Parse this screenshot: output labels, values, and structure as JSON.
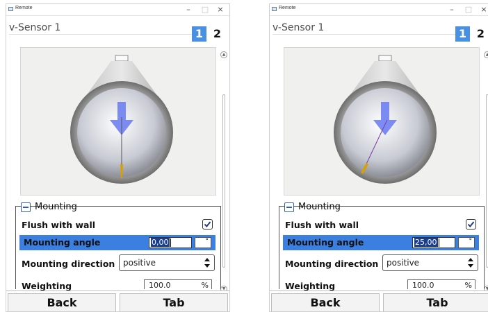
{
  "windows": [
    {
      "title": "Remote",
      "controls": {
        "minimize": "–",
        "maximize": "□",
        "close": "×"
      },
      "sensor_title": "v-Sensor 1",
      "tabs": [
        "1",
        "2"
      ],
      "mounting": {
        "group_label": "Mounting",
        "flush_label": "Flush with wall",
        "flush_checked": true,
        "angle_label": "Mounting angle",
        "angle_value": "0,00",
        "angle_unit": "°",
        "direction_label": "Mounting direction",
        "direction_value": "positive"
      },
      "weighting": {
        "label": "Weighting",
        "value": "100.0",
        "unit": "%"
      },
      "footer": {
        "back": "Back",
        "tab": "Tab"
      },
      "icons": {
        "app": "app-window-icon",
        "collapse": "collapse-minus-icon",
        "check": "checkmark-icon",
        "spinner": "up-down-arrows-icon"
      },
      "colors": {
        "highlight": "#3b7fe0",
        "tab_active": "#4a90e2",
        "flow_arrow": "#6f7ff2",
        "needle_tip": "#d8a000"
      }
    },
    {
      "title": "Remote",
      "controls": {
        "minimize": "–",
        "maximize": "□",
        "close": "×"
      },
      "sensor_title": "v-Sensor 1",
      "tabs": [
        "1",
        "2"
      ],
      "mounting": {
        "group_label": "Mounting",
        "flush_label": "Flush with wall",
        "flush_checked": true,
        "angle_label": "Mounting angle",
        "angle_value": "25,00",
        "angle_unit": "°",
        "direction_label": "Mounting direction",
        "direction_value": "positive"
      },
      "weighting": {
        "label": "Weighting",
        "value": "100.0",
        "unit": "%"
      },
      "footer": {
        "back": "Back",
        "tab": "Tab"
      },
      "icons": {
        "app": "app-window-icon",
        "collapse": "collapse-minus-icon",
        "check": "checkmark-icon",
        "spinner": "up-down-arrows-icon"
      },
      "colors": {
        "highlight": "#3b7fe0",
        "tab_active": "#4a90e2",
        "flow_arrow": "#6f7ff2",
        "needle_tip": "#d8a000"
      }
    }
  ]
}
